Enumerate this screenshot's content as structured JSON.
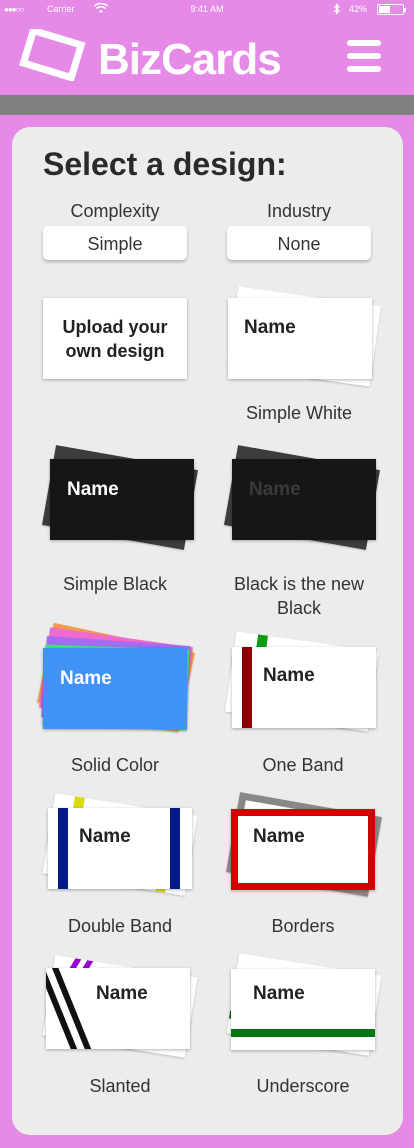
{
  "status_bar": {
    "signal": "●●●○○",
    "carrier": "Carrier",
    "time": "9:41 AM",
    "battery": "42%",
    "battery_level": 0.42
  },
  "header": {
    "title": "BizCards",
    "logo_icon": "card-logo-icon",
    "menu_icon": "hamburger-menu-icon"
  },
  "main": {
    "heading": "Select a design:",
    "filters": [
      {
        "label": "Complexity",
        "value": "Simple"
      },
      {
        "label": "Industry",
        "value": "None"
      }
    ],
    "upload": {
      "label": "Upload your own design"
    },
    "card_name": "Name",
    "designs": [
      {
        "caption": "Simple White"
      },
      {
        "caption": "Simple Black"
      },
      {
        "caption": "Black is the new Black"
      },
      {
        "caption": "Solid Color"
      },
      {
        "caption": "One Band"
      },
      {
        "caption": "Double Band"
      },
      {
        "caption": "Borders"
      },
      {
        "caption": "Slanted"
      },
      {
        "caption": "Underscore"
      }
    ]
  },
  "colors": {
    "brand": "#e68ae8",
    "solid_blue": "#4192f7",
    "band_red": "#8b0000",
    "band_navy": "#001a8c",
    "border_red": "#d40000",
    "underscore_green": "#067512",
    "slant_purple": "#9b00d6"
  }
}
